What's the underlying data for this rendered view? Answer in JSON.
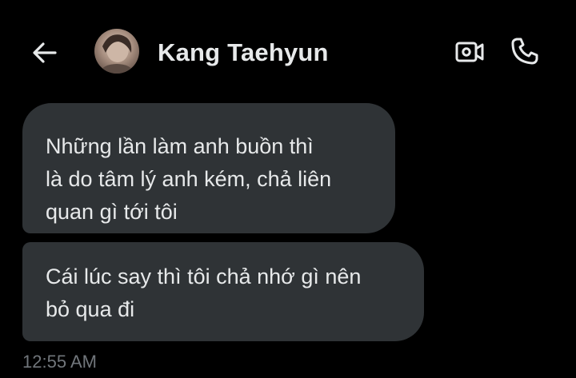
{
  "header": {
    "contact_name": "Kang Taehyun",
    "back_icon": "arrow-left-icon",
    "video_icon": "video-camera-icon",
    "call_icon": "phone-icon"
  },
  "messages": [
    {
      "lines": [
        "Những lần làm anh buồn thì",
        "là do tâm lý anh kém, chả liên",
        "quan gì tới tôi"
      ]
    },
    {
      "lines": [
        "Cái lúc say thì tôi chả nhớ gì nên",
        "bỏ qua đi"
      ]
    }
  ],
  "timestamp": "12:55 AM",
  "colors": {
    "background": "#000000",
    "bubble": "#2f3336",
    "text": "#e7e9ea",
    "muted": "#71767b"
  }
}
